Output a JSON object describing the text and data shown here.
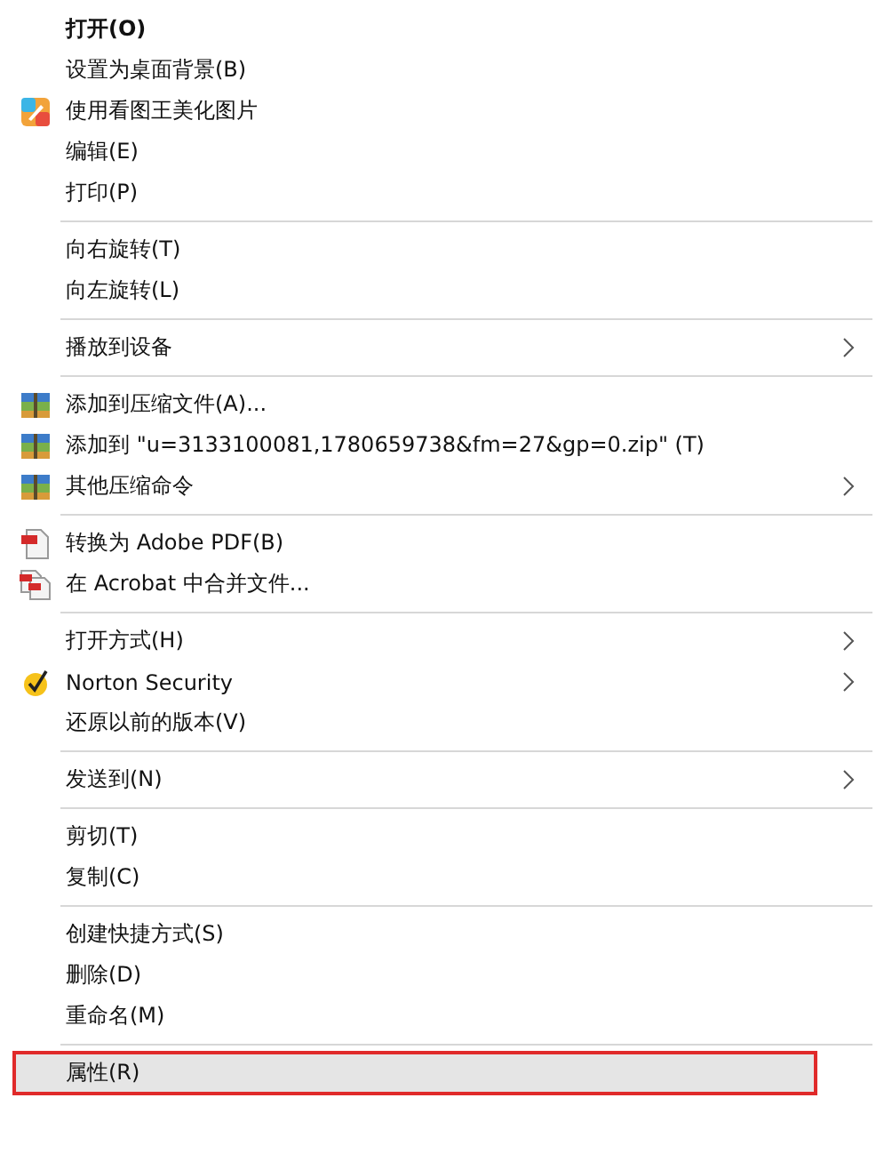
{
  "menu": {
    "groups": [
      {
        "items": [
          {
            "label": "打开(O)",
            "bold": true,
            "kind": "plain",
            "submenu": false,
            "selected": false
          },
          {
            "label": "设置为桌面背景(B)",
            "bold": false,
            "kind": "plain",
            "submenu": false,
            "selected": false
          },
          {
            "label": "使用看图王美化图片",
            "bold": false,
            "kind": "viewer",
            "submenu": false,
            "selected": false
          },
          {
            "label": "编辑(E)",
            "bold": false,
            "kind": "plain",
            "submenu": false,
            "selected": false
          },
          {
            "label": "打印(P)",
            "bold": false,
            "kind": "plain",
            "submenu": false,
            "selected": false
          }
        ]
      },
      {
        "items": [
          {
            "label": "向右旋转(T)",
            "bold": false,
            "kind": "plain",
            "submenu": false,
            "selected": false
          },
          {
            "label": "向左旋转(L)",
            "bold": false,
            "kind": "plain",
            "submenu": false,
            "selected": false
          }
        ]
      },
      {
        "items": [
          {
            "label": "播放到设备",
            "bold": false,
            "kind": "plain",
            "submenu": true,
            "selected": false
          }
        ]
      },
      {
        "items": [
          {
            "label": "添加到压缩文件(A)...",
            "bold": false,
            "kind": "archive",
            "submenu": false,
            "selected": false
          },
          {
            "label": "添加到 \"u=3133100081,1780659738&fm=27&gp=0.zip\" (T)",
            "bold": false,
            "kind": "archive",
            "submenu": false,
            "selected": false
          },
          {
            "label": "其他压缩命令",
            "bold": false,
            "kind": "archive",
            "submenu": true,
            "selected": false
          }
        ]
      },
      {
        "items": [
          {
            "label": "转换为 Adobe PDF(B)",
            "bold": false,
            "kind": "pdf",
            "submenu": false,
            "selected": false
          },
          {
            "label": "在 Acrobat 中合并文件...",
            "bold": false,
            "kind": "pdfs",
            "submenu": false,
            "selected": false
          }
        ]
      },
      {
        "items": [
          {
            "label": "打开方式(H)",
            "bold": false,
            "kind": "plain",
            "submenu": true,
            "selected": false
          },
          {
            "label": "Norton Security",
            "bold": false,
            "kind": "check",
            "submenu": true,
            "selected": false
          },
          {
            "label": "还原以前的版本(V)",
            "bold": false,
            "kind": "plain",
            "submenu": false,
            "selected": false
          }
        ]
      },
      {
        "items": [
          {
            "label": "发送到(N)",
            "bold": false,
            "kind": "plain",
            "submenu": true,
            "selected": false
          }
        ]
      },
      {
        "items": [
          {
            "label": "剪切(T)",
            "bold": false,
            "kind": "plain",
            "submenu": false,
            "selected": false
          },
          {
            "label": "复制(C)",
            "bold": false,
            "kind": "plain",
            "submenu": false,
            "selected": false
          }
        ]
      },
      {
        "items": [
          {
            "label": "创建快捷方式(S)",
            "bold": false,
            "kind": "plain",
            "submenu": false,
            "selected": false
          },
          {
            "label": "删除(D)",
            "bold": false,
            "kind": "plain",
            "submenu": false,
            "selected": false
          },
          {
            "label": "重命名(M)",
            "bold": false,
            "kind": "plain",
            "submenu": false,
            "selected": false
          }
        ]
      },
      {
        "items": [
          {
            "label": "属性(R)",
            "bold": false,
            "kind": "plain",
            "submenu": false,
            "selected": true,
            "annotated": true
          }
        ]
      }
    ]
  }
}
